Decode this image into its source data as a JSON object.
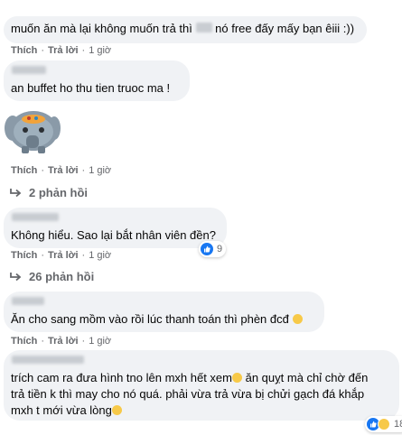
{
  "actions": {
    "like": "Thích",
    "reply": "Trả lời",
    "separator": "·",
    "time": "1 giờ"
  },
  "comments": [
    {
      "text_a": "muốn ăn mà lại không muốn trả thì",
      "text_b": "nó free đấy mấy bạn êiii :))"
    },
    {
      "text": "an buffet ho thu tien truoc ma !"
    },
    {
      "sticker": "elephant-sticker",
      "replies": "2 phản hồi"
    },
    {
      "text": "Không hiểu. Sao lại bắt nhân viên đền?",
      "reactions": "9",
      "replies": "26 phản hồi"
    },
    {
      "text": "Ăn cho sang mồm vào rồi lúc thanh toán thì phèn đcđ"
    },
    {
      "line1": "trích cam ra đưa hình tno lên mxh hết xem",
      "line1_b": "ăn quỵt mà chỉ chờ đến",
      "line2": "trả tiền k thì may cho nó quá. phải vừa trả vừa bị chửi gạch đá khắp",
      "line3": "mxh t mới vừa lòng",
      "reactions": "18"
    }
  ],
  "colors": {
    "bubble": "#f0f2f5",
    "meta": "#65676b",
    "like": "#1877f2",
    "emoji": "#f7c948"
  }
}
